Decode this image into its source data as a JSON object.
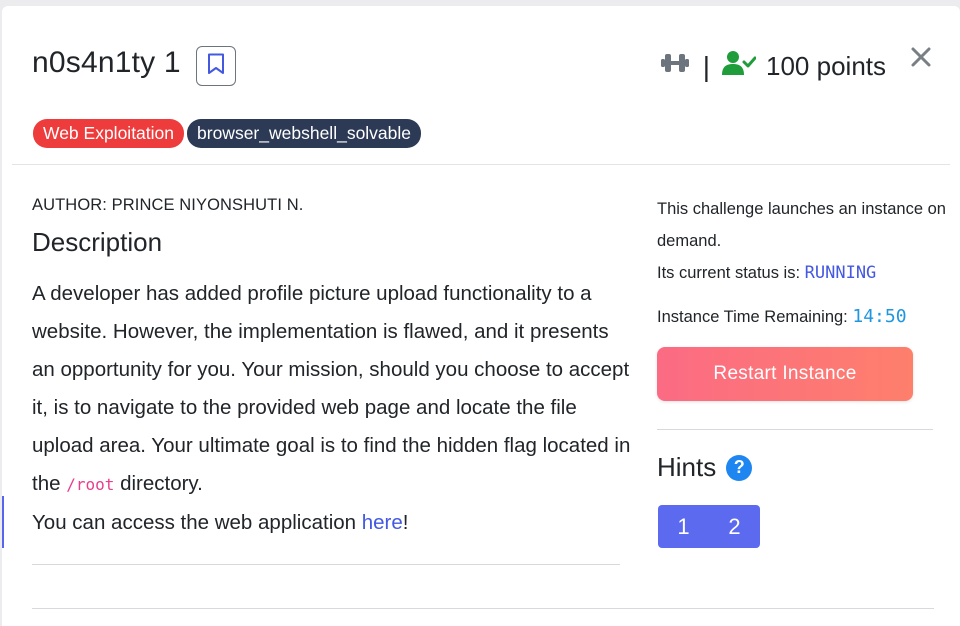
{
  "challenge": {
    "title": "n0s4n1ty 1",
    "points_label": "100 points",
    "category_tag": "Web Exploitation",
    "sub_tag": "browser_webshell_solvable",
    "author": "AUTHOR: PRINCE NIYONSHUTI N.",
    "description_heading": "Description",
    "description_p1": "A developer has added profile picture upload functionality to a website. However, the implementation is flawed, and it presents an opportunity for you. Your mission, should you choose to accept it, is to navigate to the provided web page and locate the file upload area. Your ultimate goal is to find the hidden flag located in the",
    "code_path": "/root",
    "description_p1_end": "directory.",
    "access_text": "You can access the web application",
    "access_link": "here",
    "access_end": "!"
  },
  "instance": {
    "launch_text": "This challenge launches an instance on demand.",
    "status_label": "Its current status is:",
    "status_value": "RUNNING",
    "time_label": "Instance Time Remaining:",
    "time_value": "14:50",
    "restart_label": "Restart Instance"
  },
  "hints": {
    "heading": "Hints",
    "buttons": [
      "1",
      "2"
    ]
  },
  "icons": {
    "bookmark": "bookmark-icon",
    "difficulty": "dumbbell-icon",
    "solved": "user-check-icon",
    "close": "close-icon",
    "help": "question-icon"
  },
  "colors": {
    "accent": "#5c6af0",
    "category": "#ee3c3c",
    "tag_dark": "#2c3a55",
    "solved_green": "#1f9d3a",
    "link": "#4458e0",
    "code": "#e83e8c"
  }
}
